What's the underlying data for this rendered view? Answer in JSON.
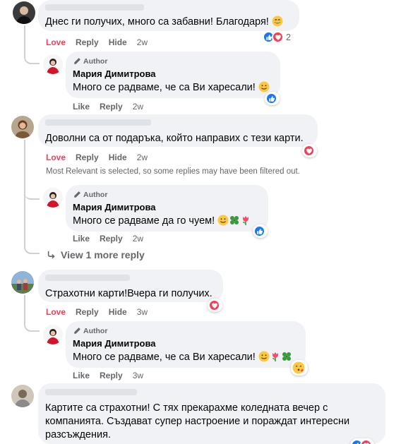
{
  "labels": {
    "love": "Love",
    "reply": "Reply",
    "hide": "Hide",
    "like": "Like",
    "author": "Author"
  },
  "comments": [
    {
      "text": "Днес ги получих, много са забавни! Благодаря!",
      "emoji": "grinning-face",
      "age": "2w",
      "reactions": {
        "types": [
          "like",
          "heart"
        ],
        "count": "2"
      },
      "reply": {
        "name": "Мария Димитрова",
        "text": "Много се радваме, че са Ви харесали!",
        "emoji": [
          "smiling-face"
        ],
        "age": "2w",
        "reactions": {
          "types": [
            "like"
          ]
        }
      }
    },
    {
      "text": "Доволни са от подаръка, който направих с тези карти.",
      "age": "2w",
      "reactions": {
        "types": [
          "heart"
        ]
      },
      "notice": "Most Relevant is selected, so some replies may have been filtered out.",
      "reply": {
        "name": "Мария Димитрова",
        "text": "Много се радваме да го чуем!",
        "emoji": [
          "smiling-face",
          "four-leaf-clover",
          "tulip"
        ],
        "age": "2w",
        "reactions": {
          "types": [
            "like"
          ]
        }
      },
      "view_more": "View 1 more reply"
    },
    {
      "text": "Страхотни карти!Вчера ги получих.",
      "age": "3w",
      "reactions": {
        "types": [
          "heart"
        ]
      },
      "reply": {
        "name": "Мария Димитрова",
        "text": "Много се радваме, че са Ви харесали!",
        "emoji": [
          "smiling-face",
          "tulip",
          "four-leaf-clover"
        ],
        "age": "3w",
        "reactions": {
          "types": [
            "kiss-face"
          ]
        }
      }
    },
    {
      "text": "Картите са страхотни! С тях прекарахме коледната вечер с компанията. Създават супер настроение и пораждат интересни разсъждения.",
      "reactions": {
        "types": [
          "like",
          "heart"
        ]
      }
    }
  ],
  "colors": {
    "love": "#f33e58",
    "like_blue": "#1877f2",
    "bubble": "#f0f2f5",
    "meta": "#65676b"
  }
}
